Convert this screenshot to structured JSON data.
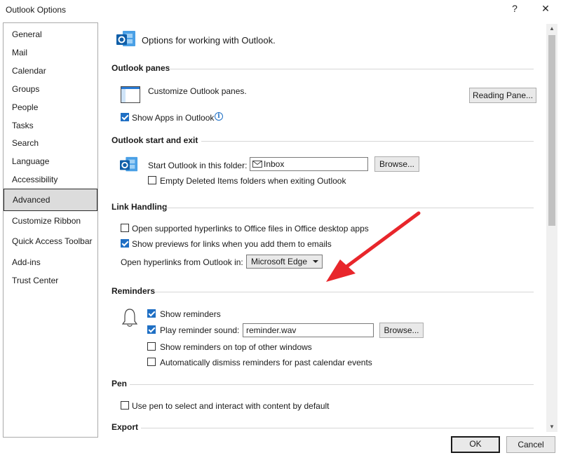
{
  "window": {
    "title": "Outlook Options",
    "help_glyph": "?",
    "close_glyph": "✕"
  },
  "sidebar": {
    "items": [
      {
        "label": "General"
      },
      {
        "label": "Mail"
      },
      {
        "label": "Calendar"
      },
      {
        "label": "Groups"
      },
      {
        "label": "People"
      },
      {
        "label": "Tasks"
      },
      {
        "label": "Search"
      },
      {
        "label": "Language"
      },
      {
        "label": "Accessibility"
      },
      {
        "label": "Advanced"
      },
      {
        "label": "Customize Ribbon"
      },
      {
        "label": "Quick Access Toolbar"
      },
      {
        "label": "Add-ins"
      },
      {
        "label": "Trust Center"
      }
    ],
    "selected": "Advanced"
  },
  "header": {
    "text": "Options for working with Outlook."
  },
  "panes": {
    "title": "Outlook panes",
    "customize_text": "Customize Outlook panes.",
    "reading_pane_button": "Reading Pane...",
    "show_apps_label": "Show Apps in Outlook",
    "show_apps_checked": true,
    "info_glyph": "i"
  },
  "start_exit": {
    "title": "Outlook start and exit",
    "start_folder_label": "Start Outlook in this folder:",
    "start_folder_value": "Inbox",
    "browse_button": "Browse...",
    "empty_deleted_label": "Empty Deleted Items folders when exiting Outlook",
    "empty_deleted_checked": false
  },
  "link_handling": {
    "title": "Link Handling",
    "open_supported_label": "Open supported hyperlinks to Office files in Office desktop apps",
    "open_supported_checked": false,
    "show_previews_label": "Show previews for links when you add them to emails",
    "show_previews_checked": true,
    "open_from_label": "Open hyperlinks from Outlook in:",
    "open_from_value": "Microsoft Edge"
  },
  "reminders": {
    "title": "Reminders",
    "show_label": "Show reminders",
    "show_checked": true,
    "play_sound_label": "Play reminder sound:",
    "play_sound_checked": true,
    "sound_file": "reminder.wav",
    "browse_button": "Browse...",
    "on_top_label": "Show reminders on top of other windows",
    "on_top_checked": false,
    "auto_dismiss_label": "Automatically dismiss reminders for past calendar events",
    "auto_dismiss_checked": false
  },
  "pen": {
    "title": "Pen",
    "use_pen_label": "Use pen to select and interact with content by default",
    "use_pen_checked": false
  },
  "export": {
    "title": "Export"
  },
  "footer": {
    "ok_label": "OK",
    "cancel_label": "Cancel"
  },
  "colors": {
    "accent": "#1f6fc4",
    "annotation_arrow": "#e8262b",
    "selected_bg": "#dcdcdc"
  }
}
